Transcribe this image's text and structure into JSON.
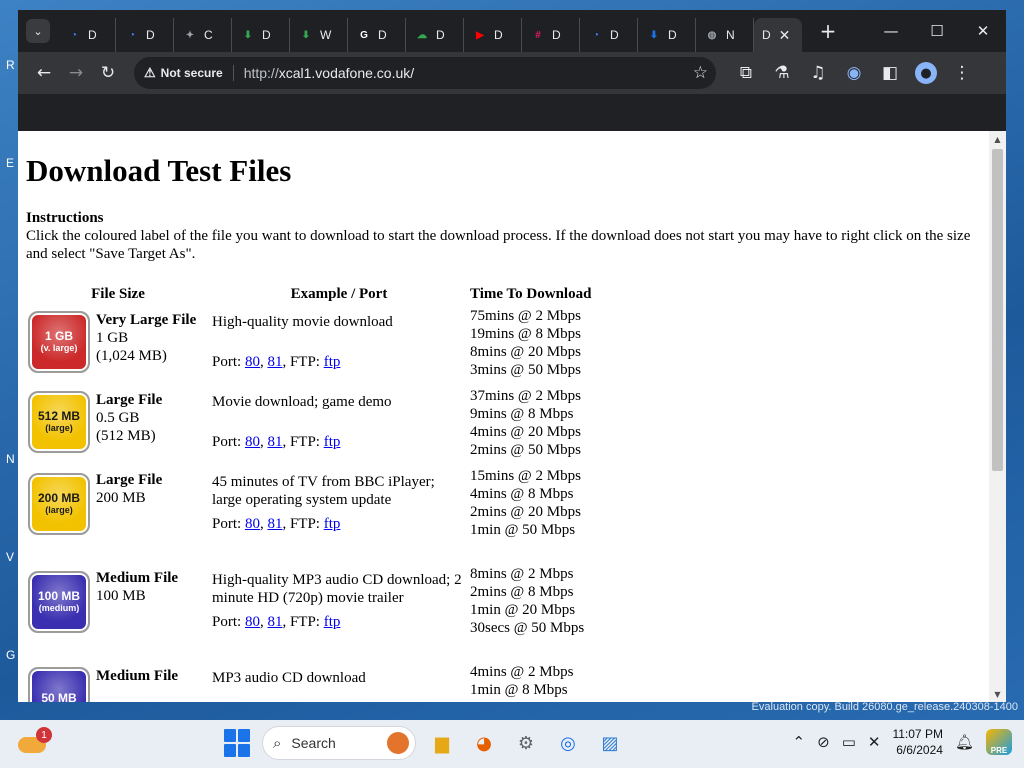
{
  "browser": {
    "tabs": [
      {
        "label": "D",
        "fav_color": "#4285f4",
        "fav_glyph": "◔"
      },
      {
        "label": "D",
        "fav_color": "#4285f4",
        "fav_glyph": "◔"
      },
      {
        "label": "C",
        "fav_color": "#9aa0a6",
        "fav_glyph": "✦"
      },
      {
        "label": "D",
        "fav_color": "#34a853",
        "fav_glyph": "⬇"
      },
      {
        "label": "W",
        "fav_color": "#34a853",
        "fav_glyph": "⬇"
      },
      {
        "label": "D",
        "fav_color": "#ffffff",
        "fav_glyph": "G"
      },
      {
        "label": "D",
        "fav_color": "#34a853",
        "fav_glyph": "☁"
      },
      {
        "label": "D",
        "fav_color": "#ff0000",
        "fav_glyph": "▶"
      },
      {
        "label": "D",
        "fav_color": "#e01e5a",
        "fav_glyph": "#"
      },
      {
        "label": "D",
        "fav_color": "#4285f4",
        "fav_glyph": "◔"
      },
      {
        "label": "D",
        "fav_color": "#1a73e8",
        "fav_glyph": "⬇"
      },
      {
        "label": "N",
        "fav_color": "#9aa0a6",
        "fav_glyph": "◍"
      }
    ],
    "active_tab": {
      "label": "D",
      "close": "✕"
    },
    "new_tab": "+",
    "window_controls": {
      "minimize": "—",
      "maximize": "☐",
      "close": "✕"
    },
    "security_chip": "Not secure",
    "url_scheme": "http://",
    "url_host": "xcal1.vodafone.co.uk/"
  },
  "page": {
    "heading": "Download Test Files",
    "instructions_title": "Instructions",
    "instructions_text": "Click the coloured label of the file you want to download to start the download process. If the download does not start you may have to right click on the size and select \"Save Target As\".",
    "columns": [
      "File Size",
      "Example / Port",
      "Time To Download"
    ],
    "port_prefix": "Port: ",
    "port_sep": ", ",
    "ftp_prefix": ", FTP: ",
    "rows": [
      {
        "badge_top": "1 GB",
        "badge_sub": "(v. large)",
        "badge_color": "#cc2a2a",
        "badge_text_color": "#ffffff",
        "title": "Very Large File",
        "size1": "1 GB",
        "size2": "(1,024 MB)",
        "example": "High-quality movie download",
        "port1": "80",
        "port2": "81",
        "ftp": "ftp",
        "times": [
          "75mins @ 2 Mbps",
          "19mins @ 8 Mbps",
          "8mins @ 20 Mbps",
          "3mins @ 50 Mbps"
        ]
      },
      {
        "badge_top": "512 MB",
        "badge_sub": "(large)",
        "badge_color": "#f2c200",
        "badge_text_color": "#1a1a1a",
        "title": "Large File",
        "size1": "0.5 GB",
        "size2": "(512 MB)",
        "example": "Movie download; game demo",
        "port1": "80",
        "port2": "81",
        "ftp": "ftp",
        "times": [
          "37mins @ 2 Mbps",
          "9mins @ 8 Mbps",
          "4mins @ 20 Mbps",
          "2mins @ 50 Mbps"
        ]
      },
      {
        "badge_top": "200 MB",
        "badge_sub": "(large)",
        "badge_color": "#f2c200",
        "badge_text_color": "#1a1a1a",
        "title": "Large File",
        "size1": "200 MB",
        "size2": "",
        "example": "45 minutes of TV from BBC iPlayer; large operating system update",
        "port1": "80",
        "port2": "81",
        "ftp": "ftp",
        "times": [
          "15mins @ 2 Mbps",
          "4mins @ 8 Mbps",
          "2mins @ 20 Mbps",
          "1min @ 50 Mbps"
        ]
      },
      {
        "badge_top": "100 MB",
        "badge_sub": "(medium)",
        "badge_color": "#3a2fb0",
        "badge_text_color": "#ffffff",
        "title": "Medium File",
        "size1": "100 MB",
        "size2": "",
        "example": "High-quality MP3 audio CD download; 2 minute HD (720p) movie trailer",
        "port1": "80",
        "port2": "81",
        "ftp": "ftp",
        "times": [
          "8mins @ 2 Mbps",
          "2mins @ 8 Mbps",
          "1min @ 20 Mbps",
          "30secs @ 50 Mbps"
        ]
      },
      {
        "badge_top": "50 MB",
        "badge_sub": "",
        "badge_color": "#3a2fb0",
        "badge_text_color": "#ffffff",
        "title": "Medium File",
        "size1": "",
        "size2": "",
        "example": "MP3 audio CD download",
        "port1": "",
        "port2": "",
        "ftp": "",
        "times": [
          "4mins @ 2 Mbps",
          "1min @ 8 Mbps"
        ]
      }
    ]
  },
  "desktop": {
    "evaluation_text": "Evaluation copy. Build 26080.ge_release.240308-1400",
    "edge_letters": [
      "R",
      "E",
      "N",
      "V",
      "G"
    ]
  },
  "taskbar": {
    "notification_count": "1",
    "search_label": "Search",
    "time": "11:07 PM",
    "date": "6/6/2024",
    "pre_badge": "PRE"
  }
}
